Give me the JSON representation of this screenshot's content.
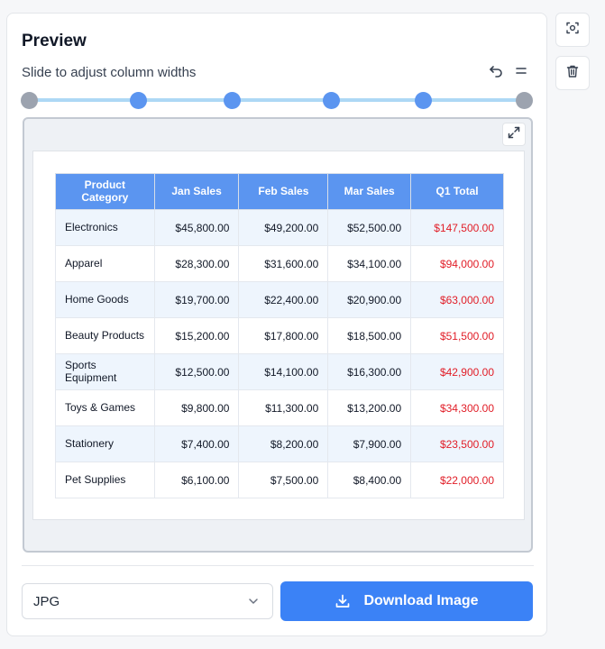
{
  "panel": {
    "title": "Preview",
    "subtitle": "Slide to adjust column widths"
  },
  "table": {
    "headers": [
      "Product Category",
      "Jan Sales",
      "Feb Sales",
      "Mar Sales",
      "Q1 Total"
    ],
    "rows": [
      [
        "Electronics",
        "$45,800.00",
        "$49,200.00",
        "$52,500.00",
        "$147,500.00"
      ],
      [
        "Apparel",
        "$28,300.00",
        "$31,600.00",
        "$34,100.00",
        "$94,000.00"
      ],
      [
        "Home Goods",
        "$19,700.00",
        "$22,400.00",
        "$20,900.00",
        "$63,000.00"
      ],
      [
        "Beauty Products",
        "$15,200.00",
        "$17,800.00",
        "$18,500.00",
        "$51,500.00"
      ],
      [
        "Sports Equipment",
        "$12,500.00",
        "$14,100.00",
        "$16,300.00",
        "$42,900.00"
      ],
      [
        "Toys & Games",
        "$9,800.00",
        "$11,300.00",
        "$13,200.00",
        "$34,300.00"
      ],
      [
        "Stationery",
        "$7,400.00",
        "$8,200.00",
        "$7,900.00",
        "$23,500.00"
      ],
      [
        "Pet Supplies",
        "$6,100.00",
        "$7,500.00",
        "$8,400.00",
        "$22,000.00"
      ]
    ]
  },
  "format_select": {
    "value": "JPG"
  },
  "download_button": {
    "label": "Download Image"
  },
  "icons": {
    "undo": "undo-icon",
    "menu": "menu-icon",
    "expand": "expand-icon",
    "screenshot": "screenshot-icon",
    "delete": "trash-icon",
    "download": "download-icon",
    "dropdown": "chevron-down-icon"
  },
  "colors": {
    "accent": "#3b82f6",
    "header": "#5b95f0",
    "total_text": "#e11d27",
    "slider_track": "#add8f5"
  }
}
